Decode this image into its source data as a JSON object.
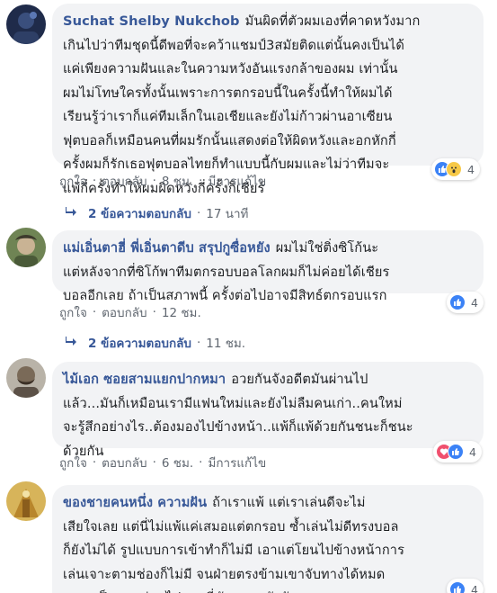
{
  "comments": [
    {
      "author": "Suchat Shelby Nukchob",
      "text": "มันผิดที่ตัวผมเองที่คาดหวังมาก\nเกินไปว่าทีมชุดนี้ดีพอที่จะคว้าแชมป์3สมัยติดแต่นั้นคงเป็นได้\nแค่เพียงความฝันและในความหวังอันแรงกล้าของผม เท่านั้น\nผมไม่โทษใครทั้งนั้นเพราะการตกรอบนี้ในครั้งนี้ทำให้ผมได้\nเรียนรู้ว่าเราก็แค่ทีมเล็กในเอเชียและยังไม่ก้าวผ่านอาเซียน\nฟุตบอลก็เหมือนคนที่ผมรักนั้นแสดงต่อให้ผิดหวังและอกหักกี่\nครั้งผมก็รักเธอฟุตบอลไทยก็ทำแบบนี้กับผมและไม่ว่าทีมจะ\nแพ้กี่ครั้งทำให้ผมผิดหวังกี่ครั้งก็เชียร์",
      "reaction_count": "4",
      "reaction_icons": [
        "like-icon",
        "wow-icon"
      ],
      "actions": {
        "like": "ถูกใจ",
        "reply": "ตอบกลับ",
        "time": "8 ชม.",
        "edited": "มีการแก้ไข"
      },
      "replies": {
        "label": "2 ข้อความตอบกลับ",
        "time": "17 นาที"
      }
    },
    {
      "author": "แม่เอิ่นตาฮี่ พี่เอิ่นตาดีบ สรุปกูซื่อหยัง",
      "text": "ผมไม่ใช่ติ่งซิโก้นะ\nแต่หลังจากที่ซิโก้พาทีมตกรอบบอลโลกผมก็ไม่ค่อยได้เชียร\nบอลอีกเลย ถ้าเป็นสภาพนี้ ครั้งต่อไปอาจมีสิทธ์ตกรอบแรก",
      "reaction_count": "4",
      "reaction_icons": [
        "like-icon"
      ],
      "actions": {
        "like": "ถูกใจ",
        "reply": "ตอบกลับ",
        "time": "12 ชม."
      },
      "replies": {
        "label": "2 ข้อความตอบกลับ",
        "time": "11 ชม."
      }
    },
    {
      "author": "ไม้เอก ซอยสามแยกปากหมา",
      "text": "อวยกันจังอดีตมันผ่านไป\nแล้ว...มันก็เหมือนเรามีแฟนใหม่และยังไม่ลืมคนเก่า..คนใหม่\nจะรู้สึกอย่างไร..ต้องมองไปข้างหน้า..แพ้ก็แพ้ด้วยกันชนะก็ชนะ\nด้วยกัน",
      "reaction_count": "4",
      "reaction_icons": [
        "love-icon",
        "like-icon"
      ],
      "actions": {
        "like": "ถูกใจ",
        "reply": "ตอบกลับ",
        "time": "6 ชม.",
        "edited": "มีการแก้ไข"
      }
    },
    {
      "author": "ของชายคนหนึ่ง ความฝัน",
      "text": "ถ้าเราแพ้ แต่เราเล่นดีจะไม่\nเสียใจเลย แต่นี่ไม่แพ้แค่เสมอแต่ตกรอบ ซ้ำเล่นไม่ดีทรงบอล\nก็ยังไม่ได้ รูปแบบการเข้าทำก็ไม่มี เอาแต่โยนไปข้างหน้าการ\nเล่นเจาะตามช่องก็ไม่มี จนฝ่ายตรงข้ามเขาจับทางได้หมด\nกลายเป็นบอลอ่อนไปเลย นี่มันถอยหลังชัดๆ",
      "reaction_count": "4",
      "reaction_icons": [
        "like-icon"
      ]
    }
  ],
  "colors": {
    "author": "#385898",
    "bubble": "#f2f3f5",
    "meta": "#606770",
    "like": "#3b82f6",
    "love": "#f0506e",
    "wow": "#f7c948"
  }
}
